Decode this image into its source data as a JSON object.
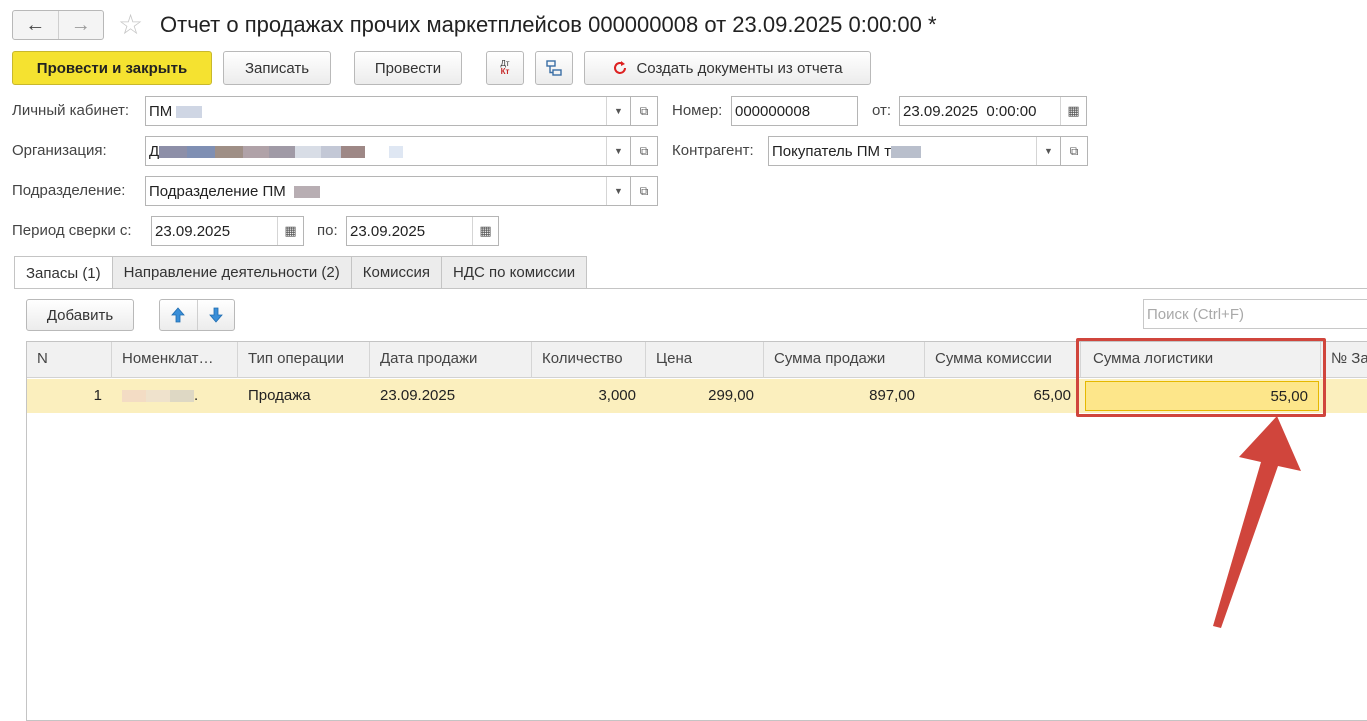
{
  "window": {
    "title": "Отчет о продажах прочих маркетплейсов 000000008 от 23.09.2025 0:00:00 *",
    "back_icon": "←",
    "forward_icon": "→",
    "star_icon": "☆"
  },
  "toolbar": {
    "post_close": "Провести и закрыть",
    "save": "Записать",
    "post": "Провести",
    "dt": "Дт",
    "kt": "Кт",
    "create_docs": "Создать документы из отчета"
  },
  "form": {
    "account_label": "Личный кабинет:",
    "account_value": "ПМ",
    "number_label": "Номер:",
    "number_value": "000000008",
    "date_label": "от:",
    "date_value": "23.09.2025  0:00:00",
    "org_label": "Организация:",
    "org_value": "Д",
    "counterparty_label": "Контрагент:",
    "counterparty_value": "Покупатель ПМ т",
    "division_label": "Подразделение:",
    "division_value": "Подразделение ПМ",
    "period_label": "Период сверки с:",
    "period_from": "23.09.2025",
    "period_to_label": "по:",
    "period_to": "23.09.2025"
  },
  "tabs": [
    {
      "label": "Запасы (1)"
    },
    {
      "label": "Направление деятельности (2)"
    },
    {
      "label": "Комиссия"
    },
    {
      "label": "НДС по комиссии"
    }
  ],
  "table_toolbar": {
    "add": "Добавить",
    "search_placeholder": "Поиск (Ctrl+F)"
  },
  "table": {
    "headers": [
      "N",
      "Номенклат…",
      "Тип операции",
      "Дата продажи",
      "Количество",
      "Цена",
      "Сумма продажи",
      "Сумма комиссии",
      "Сумма логистики",
      "№ За"
    ],
    "rows": [
      [
        "1",
        ".",
        "Продажа",
        "23.09.2025",
        "3,000",
        "299,00",
        "897,00",
        "65,00",
        "55,00",
        ""
      ]
    ]
  },
  "colors": {
    "primary_button": "#f5e230",
    "row_highlight": "#fbefbe",
    "annotation": "#d0453c"
  }
}
